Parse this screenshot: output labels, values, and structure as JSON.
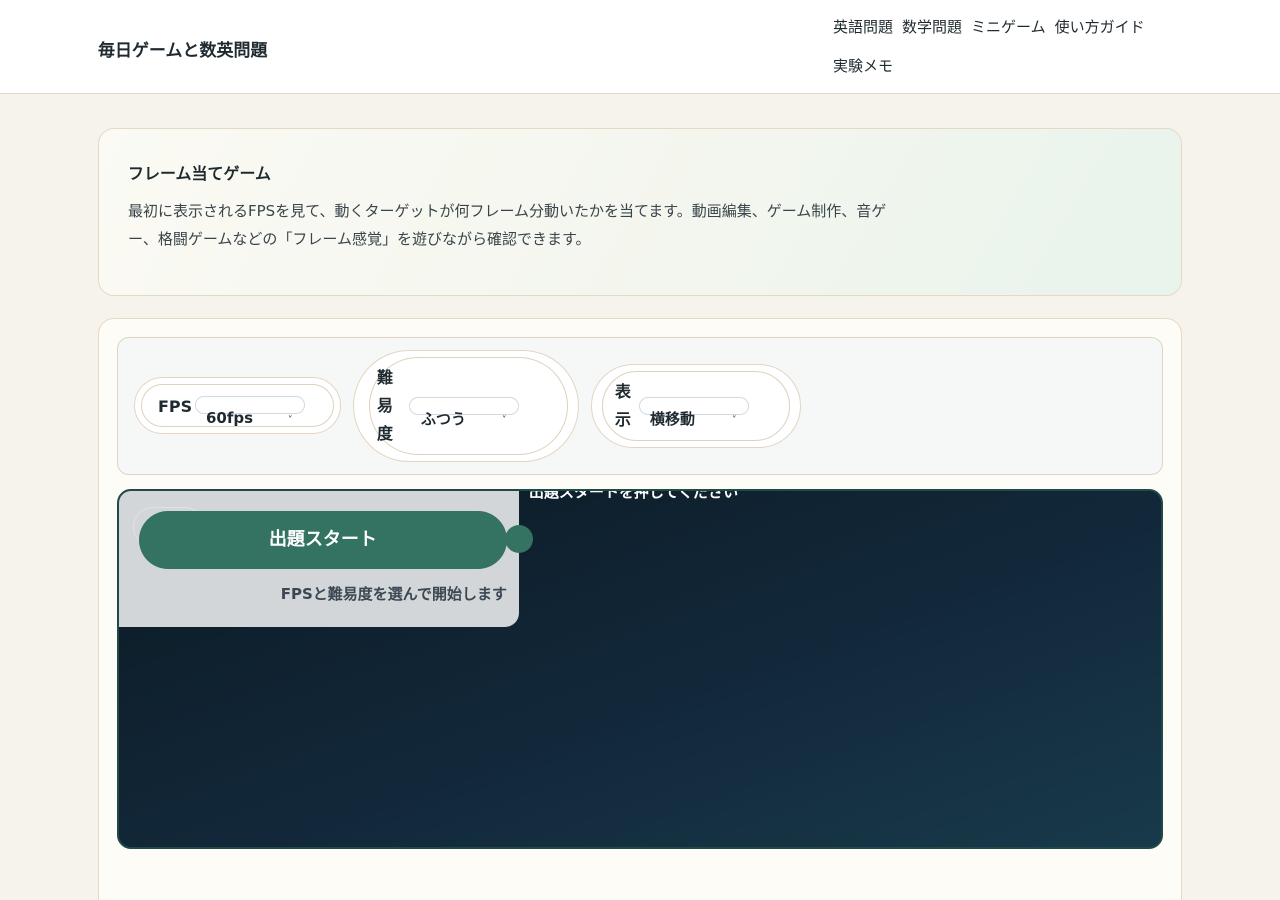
{
  "header": {
    "site_title": "毎日ゲームと数英問題",
    "nav": [
      "英語問題",
      "数学問題",
      "ミニゲーム",
      "使い方ガイド",
      "実験メモ"
    ]
  },
  "intro": {
    "title": "フレーム当てゲーム",
    "description": "最初に表示されるFPSを見て、動くターゲットが何フレーム分動いたかを当てます。動画編集、ゲーム制作、音ゲー、格闘ゲームなどの「フレーム感覚」を遊びながら確認できます。"
  },
  "controls": {
    "fps": {
      "label": "FPS",
      "value": "60fps"
    },
    "difficulty": {
      "label_chars": [
        "難",
        "易",
        "度"
      ],
      "value": "ふつう"
    },
    "display": {
      "label_chars": [
        "表",
        "示"
      ],
      "value": "横移動"
    },
    "chevron": "ˬ"
  },
  "game": {
    "hint": "出題スタートを押してください",
    "start_button": "出題スタート",
    "start_sub": "FPSと難易度を選んで開始します"
  },
  "colors": {
    "accent": "#347262",
    "game_bg_start": "#0c1a23",
    "game_bg_end": "#183a4a"
  }
}
